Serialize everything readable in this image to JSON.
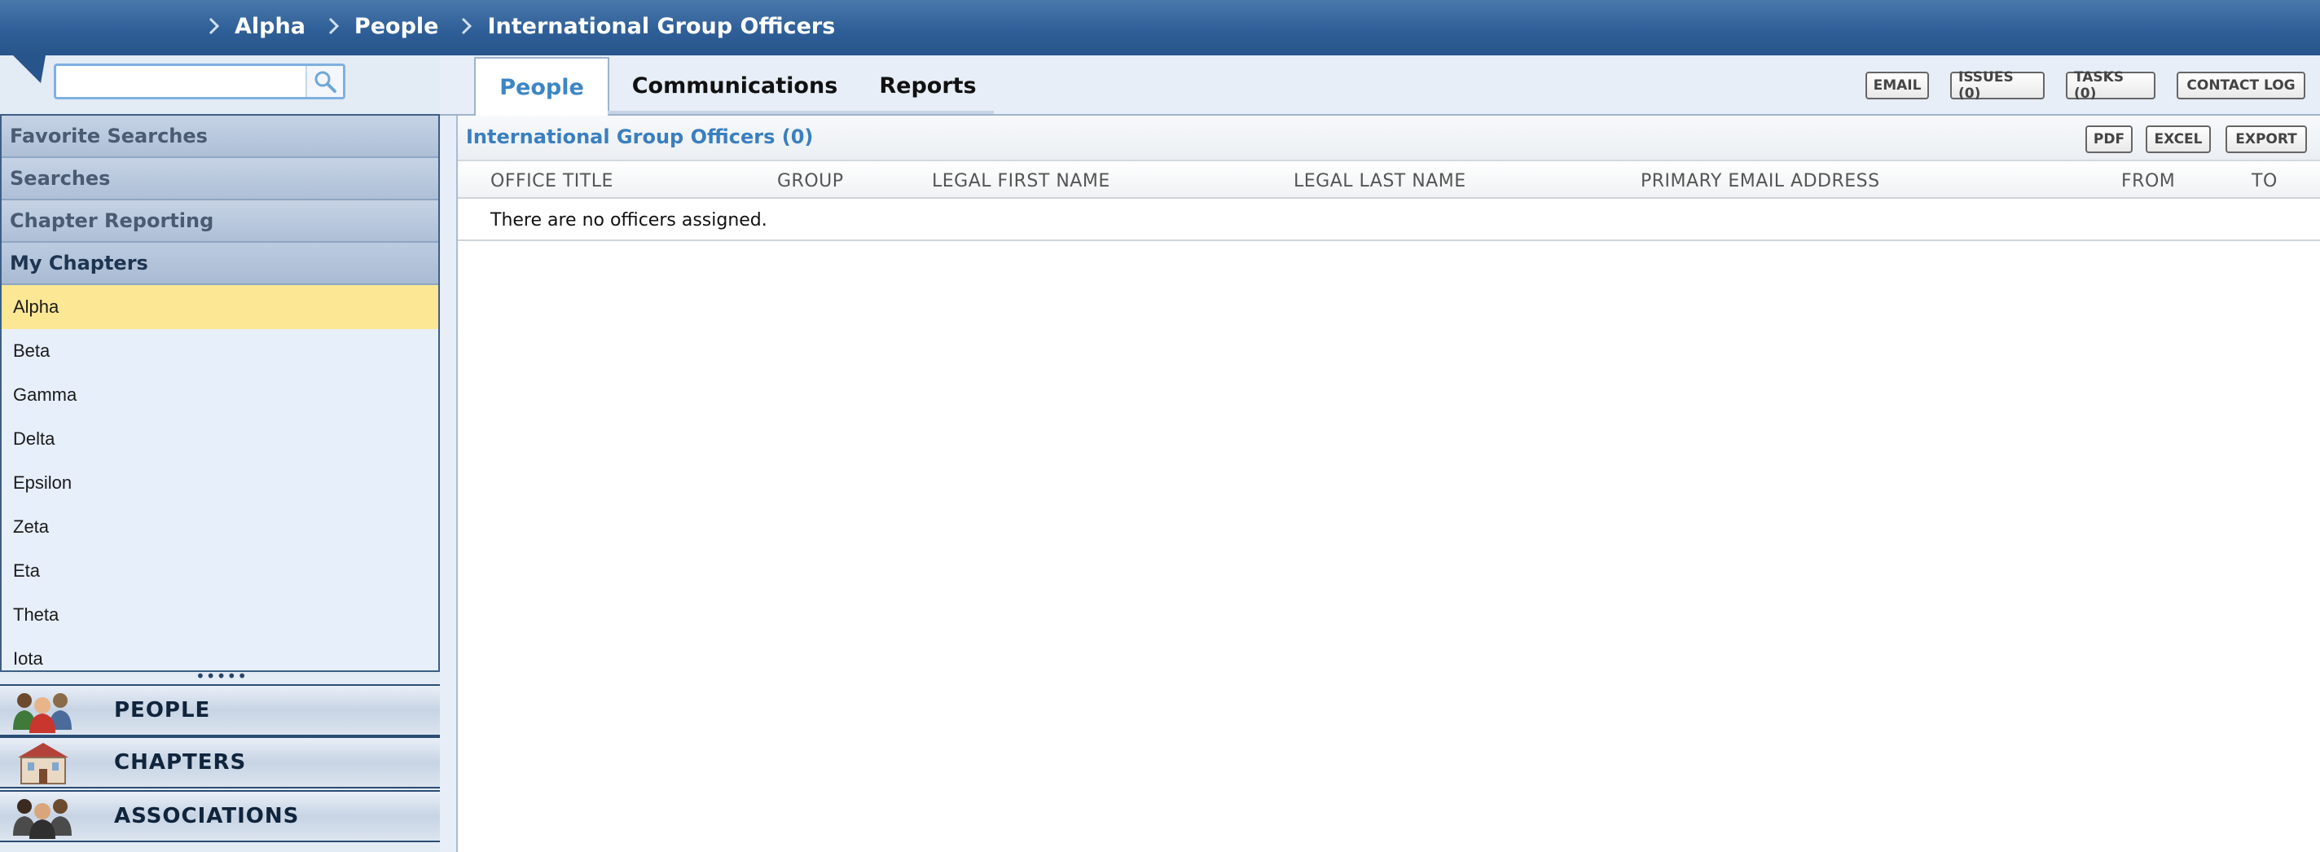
{
  "breadcrumb": {
    "items": [
      "Alpha",
      "People",
      "International Group Officers"
    ]
  },
  "search": {
    "value": "",
    "placeholder": ""
  },
  "sidebar": {
    "sections": [
      "Favorite Searches",
      "Searches",
      "Chapter Reporting",
      "My Chapters"
    ],
    "chapters": [
      "Alpha",
      "Beta",
      "Gamma",
      "Delta",
      "Epsilon",
      "Zeta",
      "Eta",
      "Theta",
      "Iota"
    ],
    "selected_chapter": "Alpha",
    "grip": "•••••"
  },
  "modules": [
    "PEOPLE",
    "CHAPTERS",
    "ASSOCIATIONS"
  ],
  "tabs": [
    {
      "label": "People",
      "active": true
    },
    {
      "label": "Communications",
      "active": false
    },
    {
      "label": "Reports",
      "active": false
    }
  ],
  "header_actions": [
    "EMAIL",
    "ISSUES (0)",
    "TASKS (0)",
    "CONTACT LOG"
  ],
  "panel": {
    "title": "International Group Officers (0)",
    "actions": [
      "PDF",
      "EXCEL",
      "EXPORT"
    ],
    "columns": [
      "OFFICE TITLE",
      "GROUP",
      "LEGAL FIRST NAME",
      "LEGAL LAST NAME",
      "PRIMARY EMAIL ADDRESS",
      "FROM",
      "TO"
    ],
    "empty_message": "There are no officers assigned."
  },
  "colors": {
    "topbar": "#2f5f98",
    "active_tab_text": "#3d86c6",
    "selected_row": "#fce794",
    "panel_title": "#3a7fbf"
  }
}
